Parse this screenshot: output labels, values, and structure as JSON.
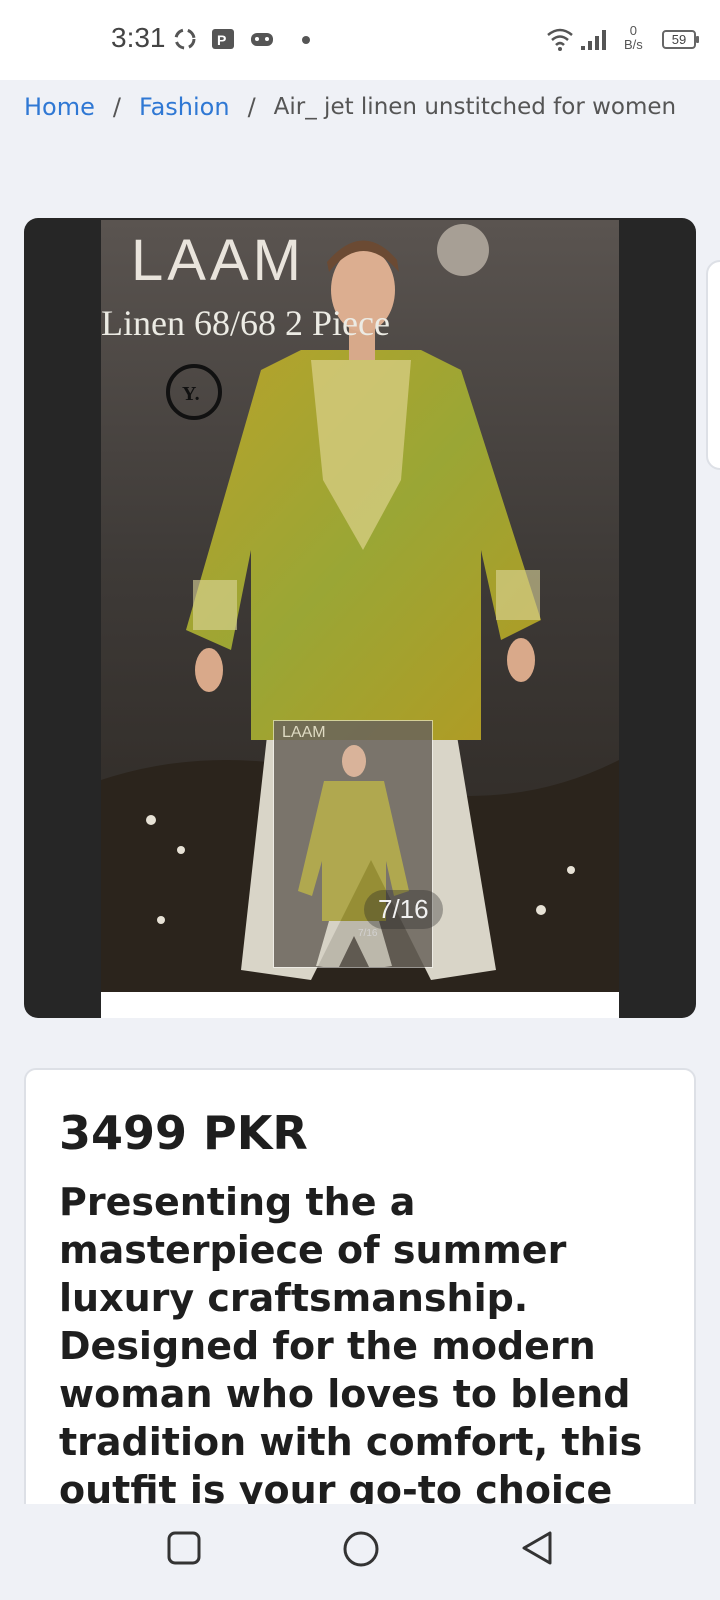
{
  "status_bar": {
    "time": "3:31",
    "net_speed_value": "0",
    "net_speed_unit": "B/s",
    "battery": "59",
    "icons": [
      "sync-icon",
      "parking-icon",
      "gamepad-icon",
      "notification-dot-icon",
      "wifi-icon",
      "signal-icon",
      "battery-icon"
    ]
  },
  "breadcrumb": {
    "home": "Home",
    "separator": "/",
    "category": "Fashion",
    "current": "Air_ jet linen unstitched for women"
  },
  "gallery": {
    "image_brand_text": "LAAM",
    "image_caption_text": "Linen 68/68 2 Piece",
    "image_logo_letter": "Y.",
    "counter": "7/16",
    "thumb_counter": "7/16"
  },
  "product": {
    "price": "3499 PKR",
    "description": "Presenting the a masterpiece of summer luxury craftsmanship. Designed for the modern woman who loves to blend tradition with comfort, this outfit is your go-to choice for daytime"
  },
  "nav_bar": {
    "icons": [
      "recent-apps-icon",
      "home-icon",
      "back-icon"
    ]
  },
  "colors": {
    "link": "#2f78d4",
    "page_background": "#eff1f6",
    "gallery_background": "#262626"
  }
}
